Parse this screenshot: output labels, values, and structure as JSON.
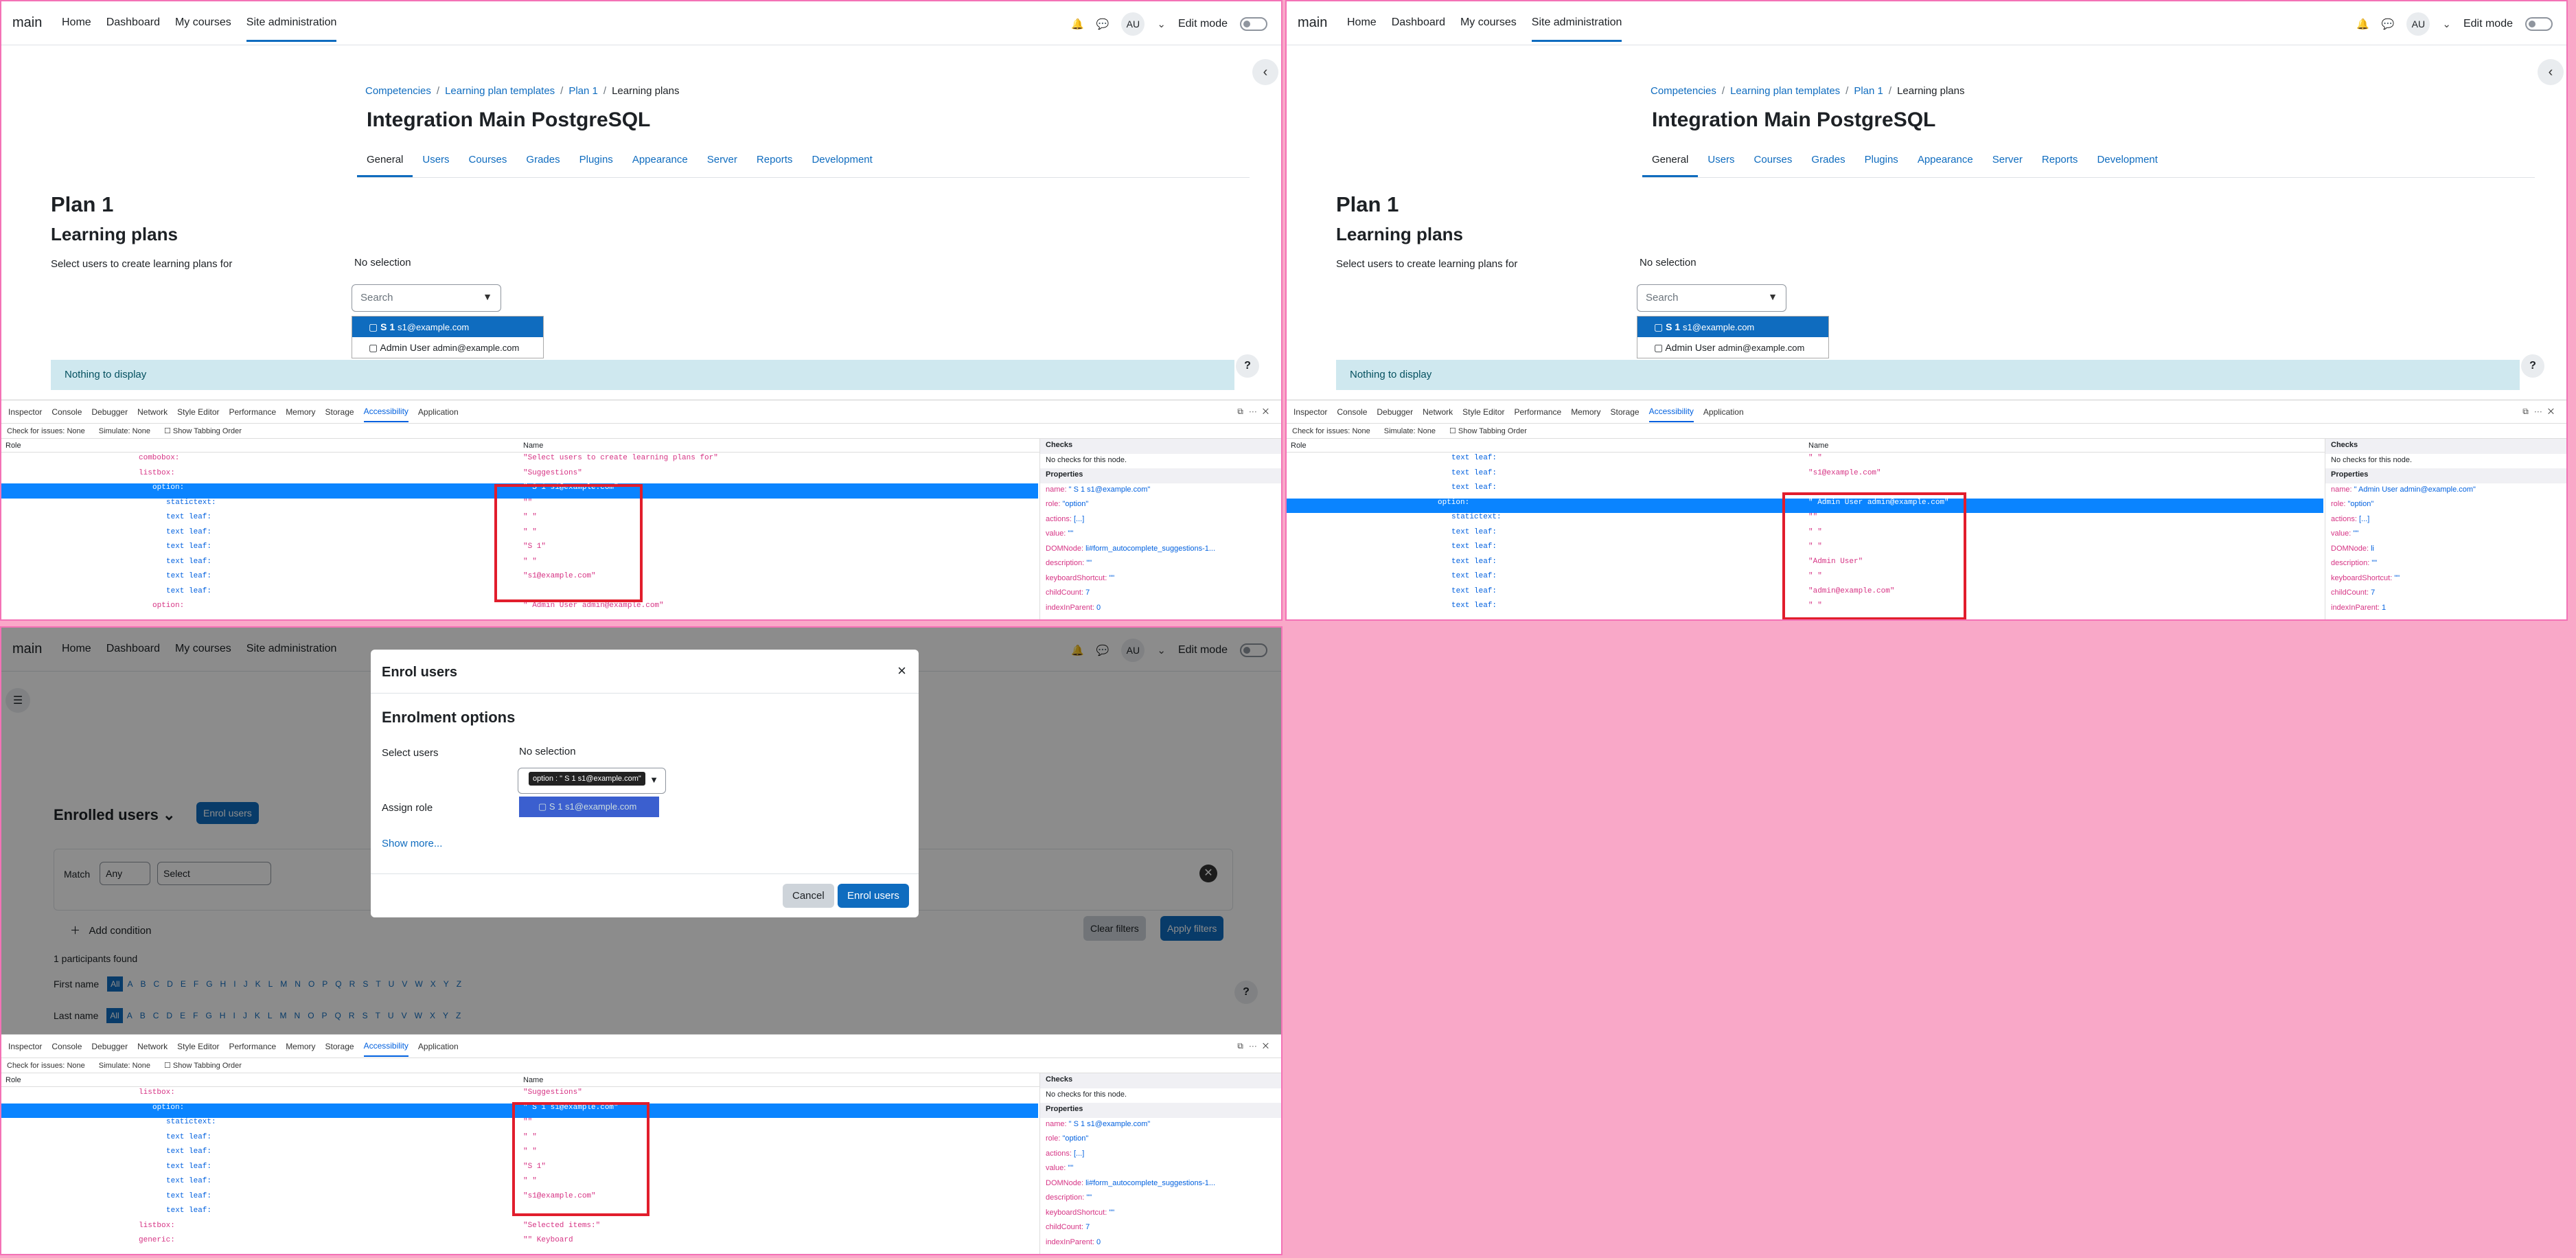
{
  "nav": {
    "brand": "main",
    "links": [
      "Home",
      "Dashboard",
      "My courses",
      "Site administration"
    ],
    "avatar": "AU",
    "edit_mode": "Edit mode"
  },
  "admin": {
    "crumbs": [
      "Competencies",
      "Learning plan templates",
      "Plan 1",
      "Learning plans"
    ],
    "site_title": "Integration Main PostgreSQL",
    "tabs": [
      "General",
      "Users",
      "Courses",
      "Grades",
      "Plugins",
      "Appearance",
      "Server",
      "Reports",
      "Development"
    ],
    "plan_title": "Plan 1",
    "section_title": "Learning plans",
    "select_label": "Select users to create learning plans for",
    "no_selection": "No selection",
    "search_placeholder": "Search",
    "options": [
      {
        "name": "S 1",
        "email": "s1@example.com"
      },
      {
        "name": "Admin User",
        "email": "admin@example.com"
      }
    ],
    "alert": "Nothing to display",
    "help": "?"
  },
  "devtools": {
    "tabs": [
      "Inspector",
      "Console",
      "Debugger",
      "Network",
      "Style Editor",
      "Performance",
      "Memory",
      "Storage",
      "Accessibility",
      "Application"
    ],
    "check_label": "Check for issues:",
    "check_value": "None",
    "simulate_label": "Simulate:",
    "simulate_value": "None",
    "tabbing": "Show Tabbing Order",
    "col_role": "Role",
    "col_name": "Name",
    "col_checks": "Checks",
    "no_checks": "No checks for this node.",
    "properties": "Properties"
  },
  "tree1": [
    {
      "role": "combobox:",
      "name": "\"Select users to create learning plans for\""
    },
    {
      "role": "listbox:",
      "name": "\"Suggestions\""
    },
    {
      "role": "option:",
      "name": "\" S 1 s1@example.com\"",
      "hl": true
    },
    {
      "role": "statictext:",
      "name": "\"\""
    },
    {
      "role": "text leaf:",
      "name": "\" \""
    },
    {
      "role": "text leaf:",
      "name": "\" \""
    },
    {
      "role": "text leaf:",
      "name": "\"S 1\""
    },
    {
      "role": "text leaf:",
      "name": "\" \""
    },
    {
      "role": "text leaf:",
      "name": "\"s1@example.com\""
    },
    {
      "role": "text leaf:",
      "name": ""
    },
    {
      "role": "option:",
      "name": "\" Admin User admin@example.com\""
    }
  ],
  "props1": [
    [
      "name:",
      "\" S 1 s1@example.com\""
    ],
    [
      "role:",
      "\"option\""
    ],
    [
      "actions:",
      "[...]"
    ],
    [
      "value:",
      "\"\""
    ],
    [
      "DOMNode:",
      "li#form_autocomplete_suggestions-1..."
    ],
    [
      "description:",
      "\"\""
    ],
    [
      "keyboardShortcut:",
      "\"\""
    ],
    [
      "childCount:",
      "7"
    ],
    [
      "indexInParent:",
      "0"
    ]
  ],
  "tree2": [
    {
      "role": "text leaf:",
      "name": "\" \""
    },
    {
      "role": "text leaf:",
      "name": "\"s1@example.com\""
    },
    {
      "role": "text leaf:",
      "name": ""
    },
    {
      "role": "option:",
      "name": "\" Admin User admin@example.com\"",
      "hl": true
    },
    {
      "role": "statictext:",
      "name": "\"\""
    },
    {
      "role": "text leaf:",
      "name": "\" \""
    },
    {
      "role": "text leaf:",
      "name": "\" \""
    },
    {
      "role": "text leaf:",
      "name": "\"Admin User\""
    },
    {
      "role": "text leaf:",
      "name": "\" \""
    },
    {
      "role": "text leaf:",
      "name": "\"admin@example.com\""
    },
    {
      "role": "text leaf:",
      "name": "\" \""
    }
  ],
  "props2": [
    [
      "name:",
      "\" Admin User admin@example.com\""
    ],
    [
      "role:",
      "\"option\""
    ],
    [
      "actions:",
      "[...]"
    ],
    [
      "value:",
      "\"\""
    ],
    [
      "DOMNode:",
      "li"
    ],
    [
      "description:",
      "\"\""
    ],
    [
      "keyboardShortcut:",
      "\"\""
    ],
    [
      "childCount:",
      "7"
    ],
    [
      "indexInParent:",
      "1"
    ]
  ],
  "course": {
    "enrolled": "Enrolled users",
    "enrol_btn": "Enrol users",
    "match": "Match",
    "any": "Any",
    "select": "Select",
    "add_condition": "Add condition",
    "clear": "Clear filters",
    "apply": "Apply filters",
    "found": "1 participants found",
    "first_name": "First name",
    "last_name": "Last name",
    "all": "All",
    "letters": [
      "A",
      "B",
      "C",
      "D",
      "E",
      "F",
      "G",
      "H",
      "I",
      "J",
      "K",
      "L",
      "M",
      "N",
      "O",
      "P",
      "Q",
      "R",
      "S",
      "T",
      "U",
      "V",
      "W",
      "X",
      "Y",
      "Z"
    ]
  },
  "modal": {
    "title": "Enrol users",
    "heading": "Enrolment options",
    "select_users": "Select users",
    "no_selection": "No selection",
    "tooltip": "option : \" S 1 s1@example.com\"",
    "option": "S 1",
    "option_email": "s1@example.com",
    "assign_role": "Assign role",
    "show_more": "Show more...",
    "cancel": "Cancel",
    "enrol": "Enrol users"
  },
  "tree3": [
    {
      "role": "listbox:",
      "name": "\"Suggestions\""
    },
    {
      "role": "option:",
      "name": "\" S 1 s1@example.com\"",
      "hl": true
    },
    {
      "role": "statictext:",
      "name": "\"\""
    },
    {
      "role": "text leaf:",
      "name": "\" \""
    },
    {
      "role": "text leaf:",
      "name": "\" \""
    },
    {
      "role": "text leaf:",
      "name": "\"S 1\""
    },
    {
      "role": "text leaf:",
      "name": "\" \""
    },
    {
      "role": "text leaf:",
      "name": "\"s1@example.com\""
    },
    {
      "role": "text leaf:",
      "name": ""
    },
    {
      "role": "listbox:",
      "name": "\"Selected items:\""
    },
    {
      "role": "generic:",
      "name": "\"\" Keyboard"
    }
  ],
  "props3": [
    [
      "name:",
      "\" S 1 s1@example.com\""
    ],
    [
      "role:",
      "\"option\""
    ],
    [
      "actions:",
      "[...]"
    ],
    [
      "value:",
      "\"\""
    ],
    [
      "DOMNode:",
      "li#form_autocomplete_suggestions-1..."
    ],
    [
      "description:",
      "\"\""
    ],
    [
      "keyboardShortcut:",
      "\"\""
    ],
    [
      "childCount:",
      "7"
    ],
    [
      "indexInParent:",
      "0"
    ]
  ]
}
